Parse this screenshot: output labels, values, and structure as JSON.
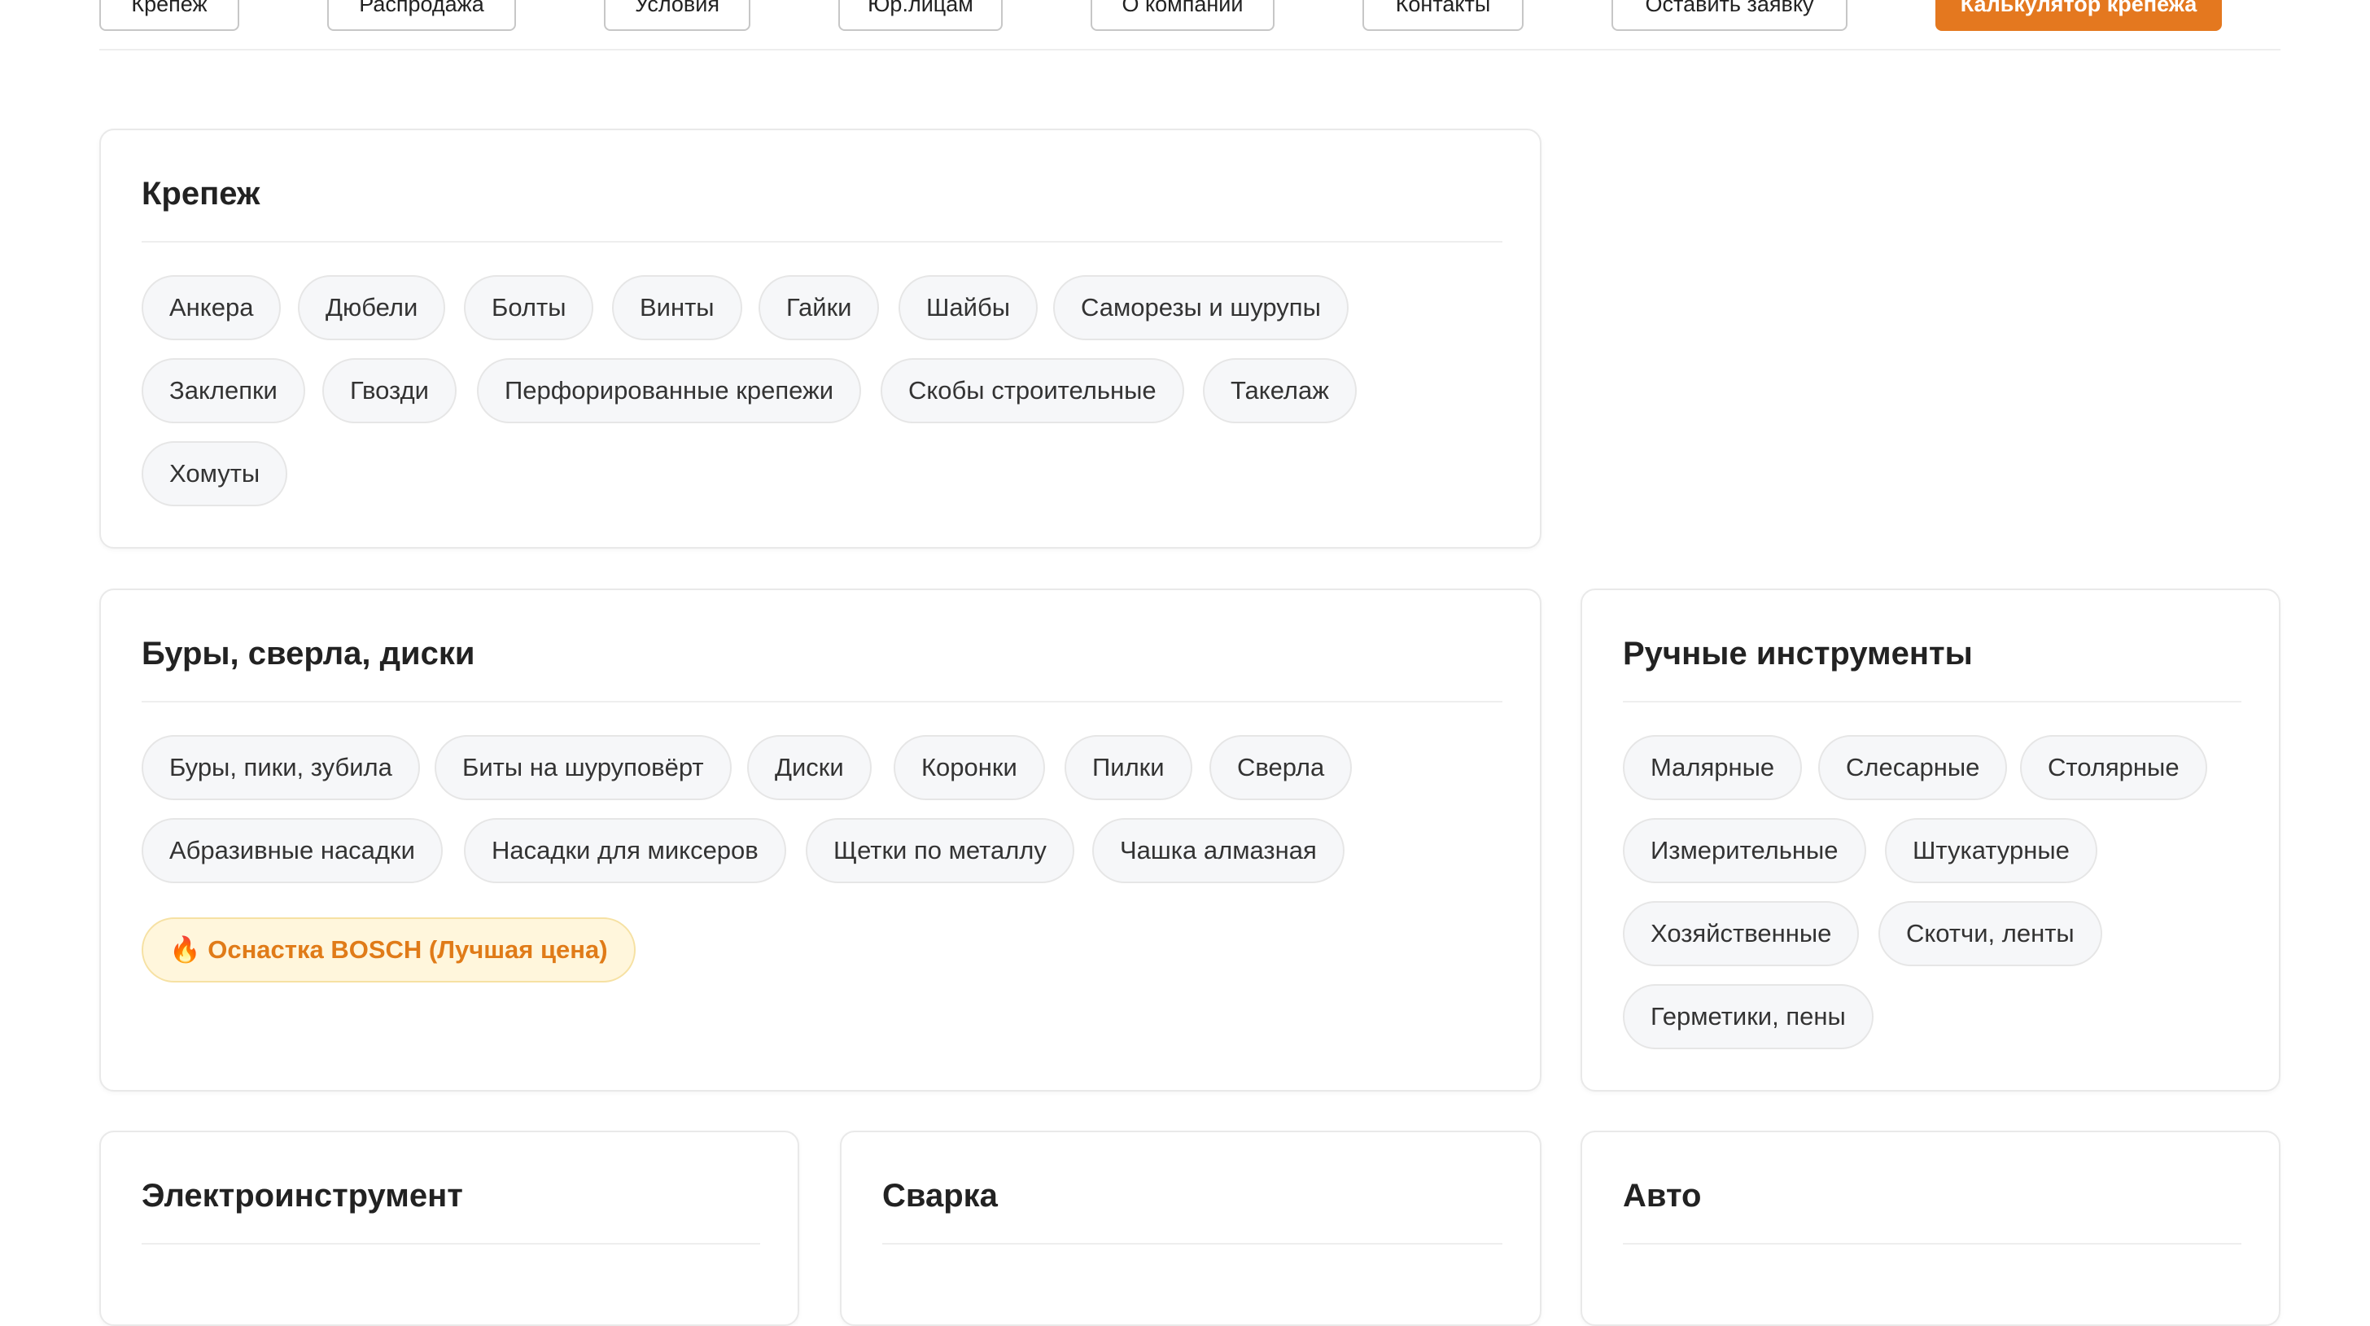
{
  "nav": {
    "items": [
      "Крепеж",
      "Распродажа",
      "Условия",
      "Юр.лицам",
      "О компании",
      "Контакты",
      "Оставить заявку",
      "Калькулятор крепежа"
    ],
    "accent_color": "#e4781f"
  },
  "cards": {
    "krepezh": {
      "title": "Крепеж",
      "chips": [
        "Анкера",
        "Дюбели",
        "Болты",
        "Винты",
        "Гайки",
        "Шайбы",
        "Саморезы и шурупы",
        "Заклепки",
        "Гвозди",
        "Перфорированные крепежи",
        "Скобы строительные",
        "Такелаж",
        "Хомуты"
      ]
    },
    "bury": {
      "title": "Буры, сверла, диски",
      "chips": [
        "Буры, пики, зубила",
        "Биты на шуруповёрт",
        "Диски",
        "Коронки",
        "Пилки",
        "Сверла",
        "Абразивные насадки",
        "Насадки для миксеров",
        "Щетки по металлу",
        "Чашка алмазная"
      ],
      "promo": "🔥 Оснастка BOSCH (Лучшая цена)"
    },
    "ruchnye": {
      "title": "Ручные инструменты",
      "chips": [
        "Малярные",
        "Слесарные",
        "Столярные",
        "Измерительные",
        "Штукатурные",
        "Хозяйственные",
        "Скотчи, ленты",
        "Герметики, пены"
      ]
    },
    "elektro": {
      "title": "Электроинструмент"
    },
    "svarka": {
      "title": "Сварка"
    },
    "avto": {
      "title": "Авто"
    }
  },
  "colors": {
    "chip_bg": "#f6f7f9",
    "promo_bg": "#fff6dc",
    "promo_text": "#e07b18"
  }
}
